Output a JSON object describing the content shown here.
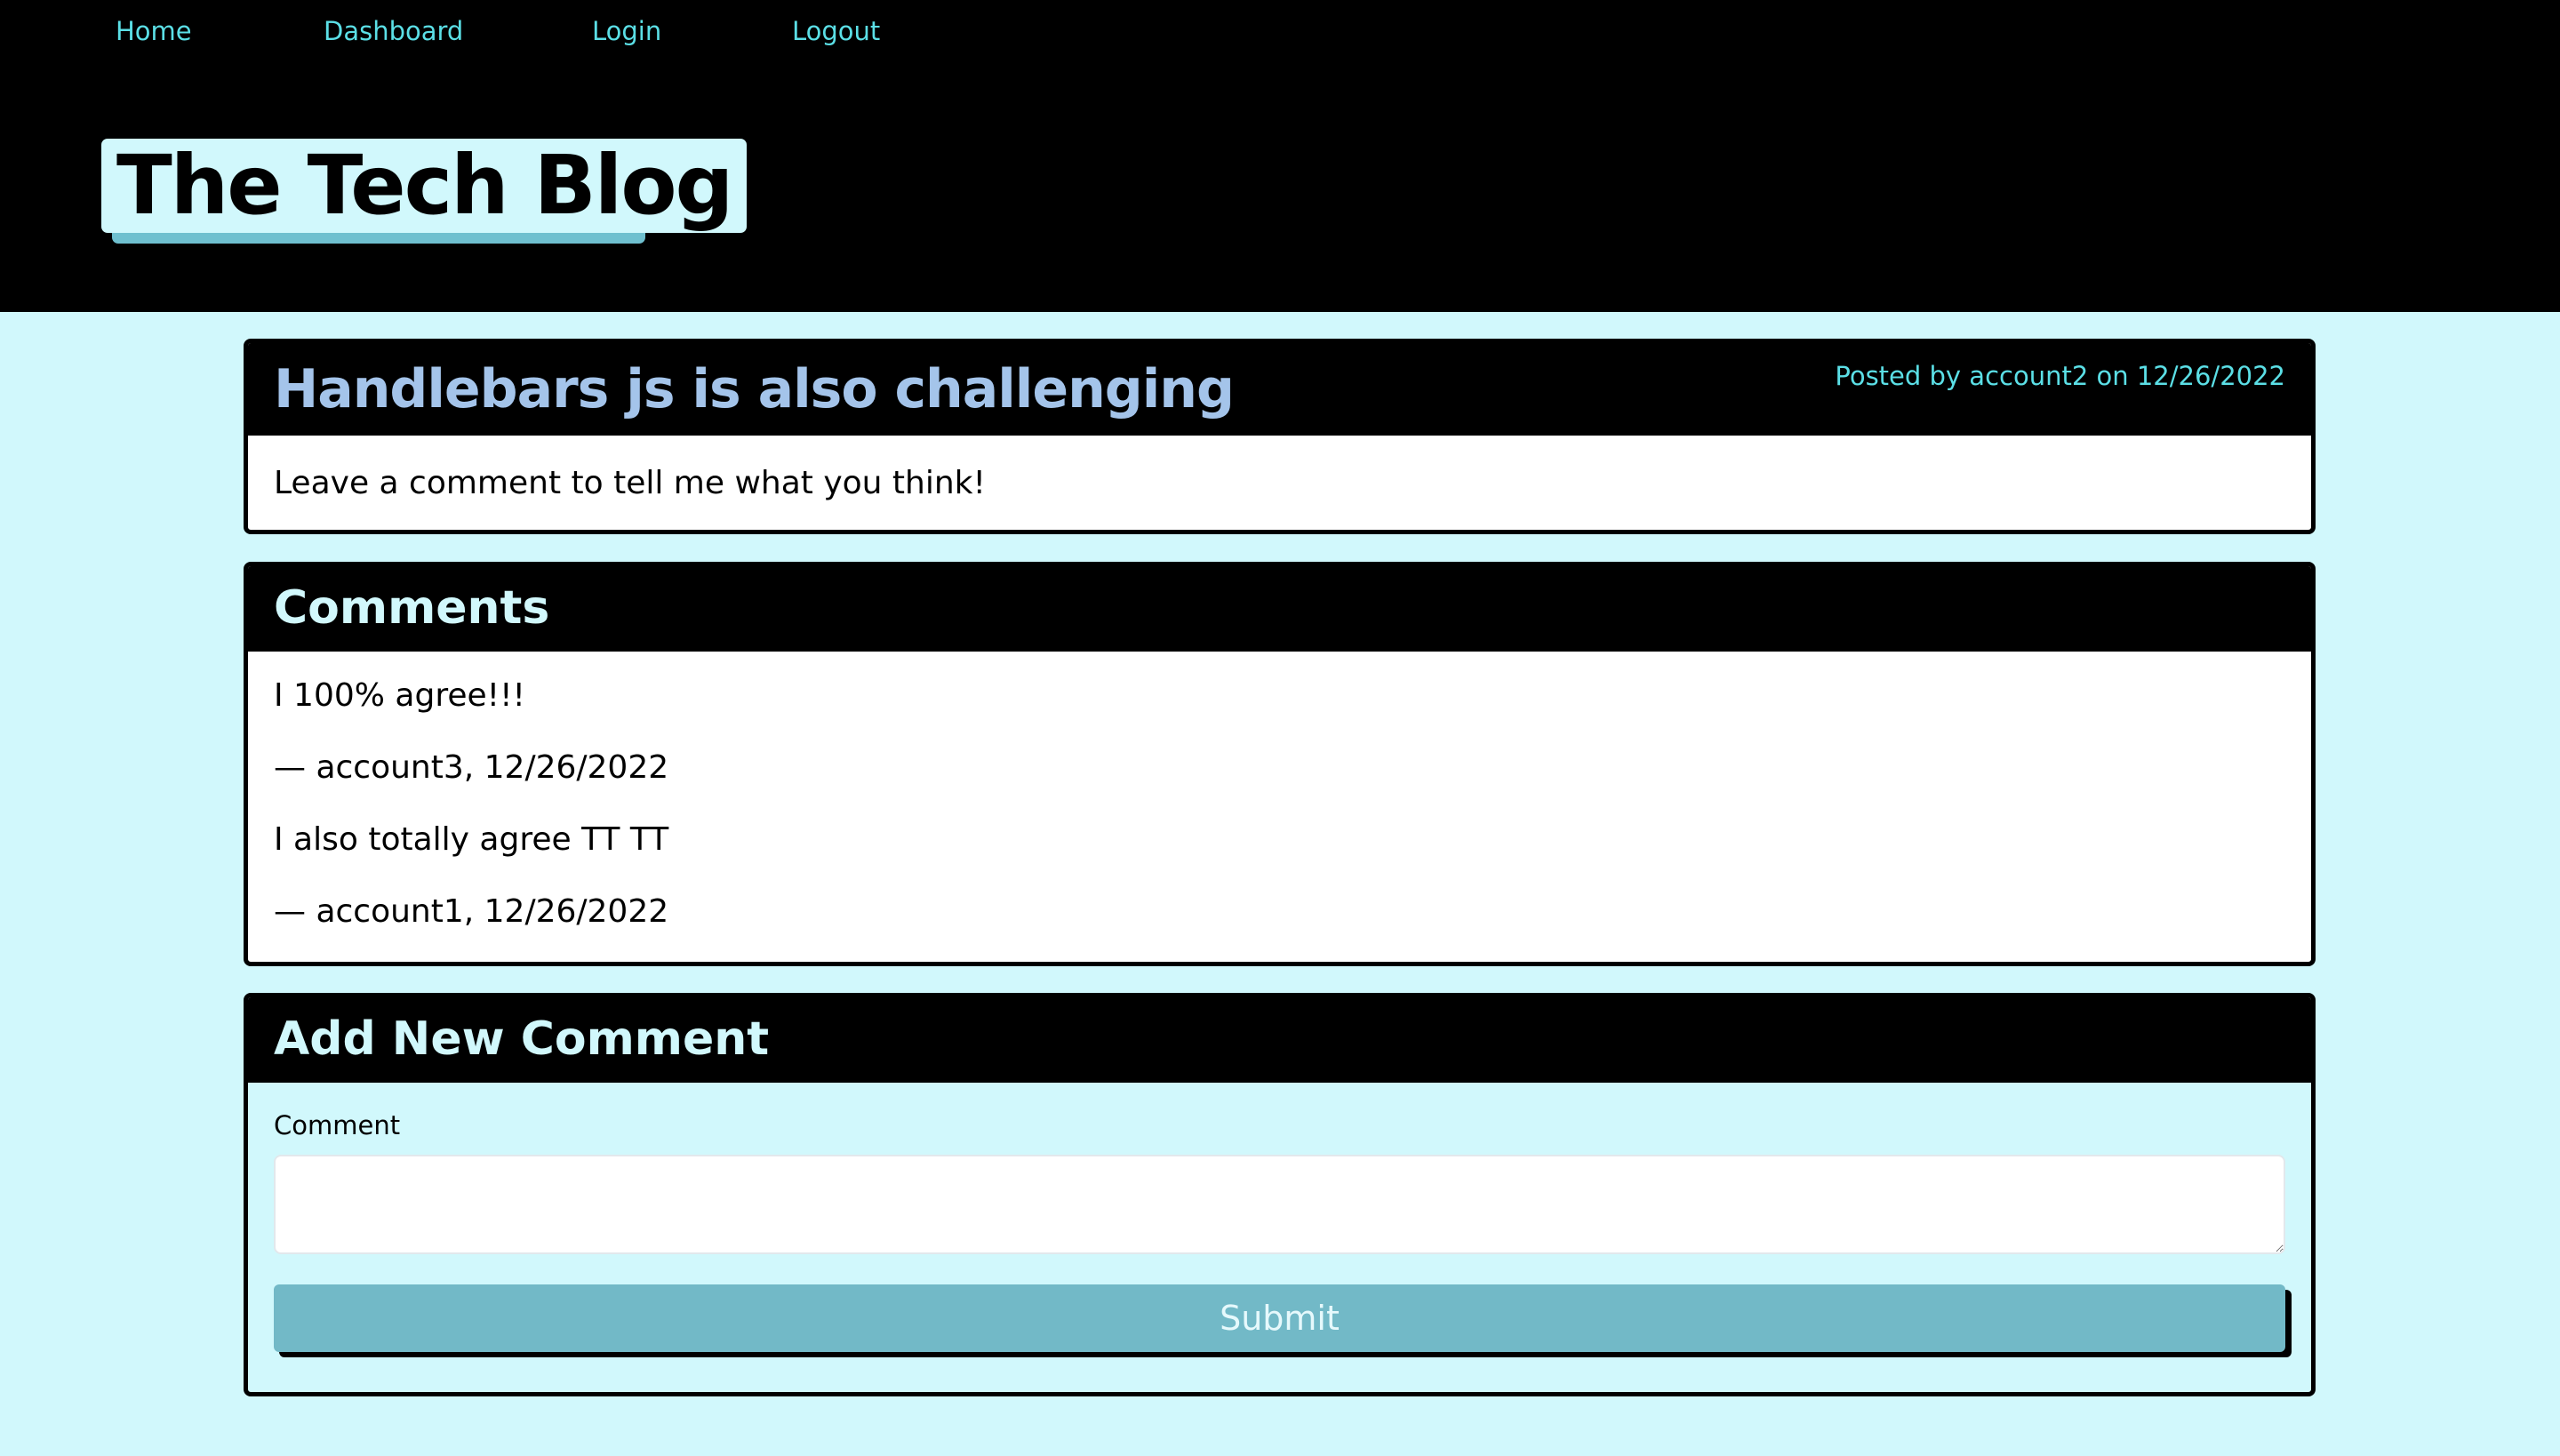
{
  "nav": {
    "home": "Home",
    "dashboard": "Dashboard",
    "login": "Login",
    "logout": "Logout"
  },
  "site_title": "The Tech Blog",
  "post": {
    "title": "Handlebars js is also challenging",
    "meta": "Posted by account2 on 12/26/2022",
    "body": "Leave a comment to tell me what you think!"
  },
  "comments": {
    "heading": "Comments",
    "items": [
      {
        "text": "I 100% agree!!!",
        "meta": "— account3, 12/26/2022"
      },
      {
        "text": "I also totally agree TT TT",
        "meta": "— account1, 12/26/2022"
      }
    ]
  },
  "add_comment": {
    "heading": "Add New Comment",
    "label": "Comment",
    "value": "",
    "submit_label": "Submit"
  },
  "colors": {
    "page_bg": "#d1f8fc",
    "header_bg": "#000000",
    "nav_link": "#5bdfe6",
    "post_title": "#a4c4ea",
    "button_bg": "#72b9c7"
  }
}
